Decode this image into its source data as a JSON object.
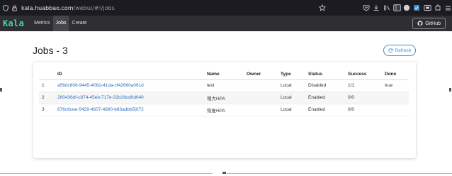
{
  "browser": {
    "url_host": "kala.huabbao.com",
    "url_path": "/webui/#!/jobs"
  },
  "navbar": {
    "brand": "Kala",
    "links": [
      {
        "label": "Metrics"
      },
      {
        "label": "Jobs"
      },
      {
        "label": "Create"
      }
    ],
    "active_link": "Jobs",
    "github_label": "GitHub"
  },
  "page": {
    "title": "Jobs - 3",
    "refresh_label": "Refresh"
  },
  "table": {
    "headers": [
      "",
      "ID",
      "Name",
      "Owner",
      "Type",
      "Status",
      "Success",
      "Done"
    ],
    "rows": [
      {
        "index": "1",
        "id": "a56dc606-9445-406d-41da-cf42660a061d",
        "name": "test",
        "owner": "",
        "type": "Local",
        "status": "Disabled",
        "success": "1/1",
        "done": "true"
      },
      {
        "index": "2",
        "id": "260436df-c874-45eb-717e-32b26cd0d640",
        "name": "增大HPA",
        "owner": "",
        "type": "Local",
        "status": "Enabled",
        "success": "0/0",
        "done": ""
      },
      {
        "index": "3",
        "id": "676c6cee-5429-4607-4890-b83adbb5|072",
        "name": "恢复HPA",
        "owner": "",
        "type": "Local",
        "status": "Enabled",
        "success": "0/0",
        "done": ""
      }
    ]
  },
  "colors": {
    "brand": "#45d3a5",
    "link": "#2f6fbd",
    "refresh_accent": "#3f8fd2",
    "navbar_bg": "#2f2f33",
    "browser_bg": "#1c1b22"
  }
}
